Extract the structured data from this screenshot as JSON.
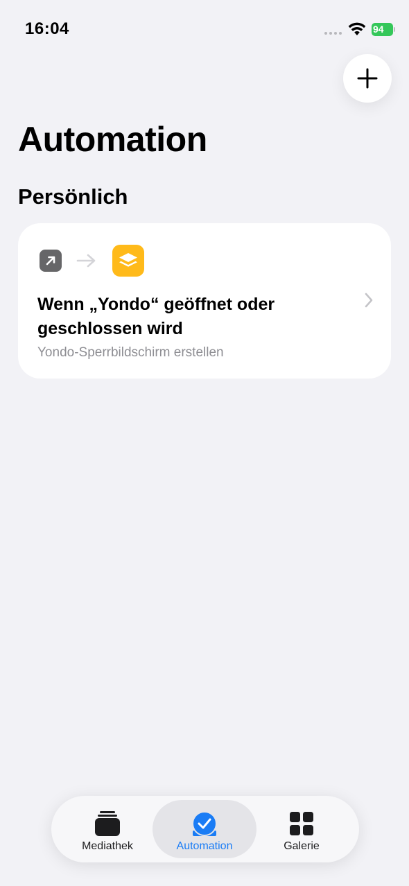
{
  "status_bar": {
    "time": "16:04",
    "battery_level": "94",
    "battery_color": "#34c759"
  },
  "header": {
    "add_button_icon": "plus-icon",
    "title": "Automation"
  },
  "section": {
    "title": "Persönlich"
  },
  "automation_card": {
    "trigger_icon": "open-app-arrow-icon",
    "app_icon": "yondo-app-icon",
    "app_icon_color": "#ffba1a",
    "title": "Wenn „Yondo“ geöffnet oder geschlossen wird",
    "subtitle": "Yondo-Sperrbildschirm erstellen"
  },
  "tab_bar": {
    "accent_color": "#1a7cf5",
    "tabs": [
      {
        "label": "Mediathek",
        "icon": "library-stack-icon",
        "selected": false
      },
      {
        "label": "Automation",
        "icon": "automation-check-icon",
        "selected": true
      },
      {
        "label": "Galerie",
        "icon": "gallery-grid-icon",
        "selected": false
      }
    ]
  }
}
